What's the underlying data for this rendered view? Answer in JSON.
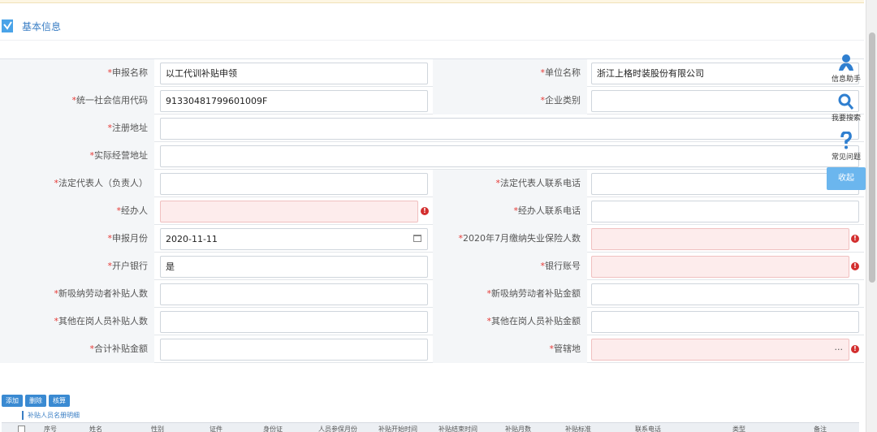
{
  "section": {
    "title": "基本信息"
  },
  "form": {
    "rows": [
      {
        "left": {
          "label": "申报名称",
          "value": "以工代训补贴申领"
        },
        "right": {
          "label": "单位名称",
          "value": "浙江上格时装股份有限公司"
        }
      },
      {
        "left": {
          "label": "统一社会信用代码",
          "value": "91330481799601009F"
        },
        "right": {
          "label": "企业类别",
          "value": ""
        }
      },
      {
        "full": {
          "label": "注册地址",
          "value": ""
        }
      },
      {
        "full": {
          "label": "实际经营地址",
          "value": ""
        }
      },
      {
        "left": {
          "label": "法定代表人（负责人）",
          "value": ""
        },
        "right": {
          "label": "法定代表人联系电话",
          "value": ""
        }
      },
      {
        "left": {
          "label": "经办人",
          "value": ""
        },
        "right": {
          "label": "经办人联系电话",
          "value": ""
        }
      },
      {
        "left": {
          "label": "申报月份",
          "value": "2020-11-11"
        },
        "right": {
          "label": "2020年7月缴纳失业保险人数",
          "value": ""
        }
      },
      {
        "left": {
          "label": "开户银行",
          "value": "是"
        },
        "right": {
          "label": "银行账号",
          "value": ""
        }
      },
      {
        "left": {
          "label": "新吸纳劳动者补贴人数",
          "value": ""
        },
        "right": {
          "label": "新吸纳劳动者补贴金额",
          "value": ""
        }
      },
      {
        "left": {
          "label": "其他在岗人员补贴人数",
          "value": ""
        },
        "right": {
          "label": "其他在岗人员补贴金额",
          "value": ""
        }
      },
      {
        "left": {
          "label": "合计补贴金额",
          "value": ""
        },
        "right": {
          "label": "管辖地",
          "value": ""
        }
      }
    ],
    "required_mark": "*",
    "error_mark": "!",
    "picker_ellipsis": "···"
  },
  "side_panel": {
    "items": [
      {
        "label": "信息助手",
        "icon": "person-icon"
      },
      {
        "label": "我要搜索",
        "icon": "search-icon"
      },
      {
        "label": "常见问题",
        "icon": "question-icon"
      }
    ],
    "collapse_label": "收起"
  },
  "actions": {
    "add": "添加",
    "delete": "删除",
    "import": "核算"
  },
  "detail": {
    "subtitle": "补贴人员名册明细",
    "columns": [
      "序号",
      "姓名",
      "性别",
      "证件",
      "身份证",
      "人员参保月份",
      "补贴开始时间",
      "补贴结束时间",
      "补贴月数",
      "补贴标准",
      "联系电话",
      "类型",
      "备注"
    ]
  },
  "colors": {
    "accent": "#3a7ec4",
    "required": "#e53935",
    "error_bg": "#fdecec"
  }
}
